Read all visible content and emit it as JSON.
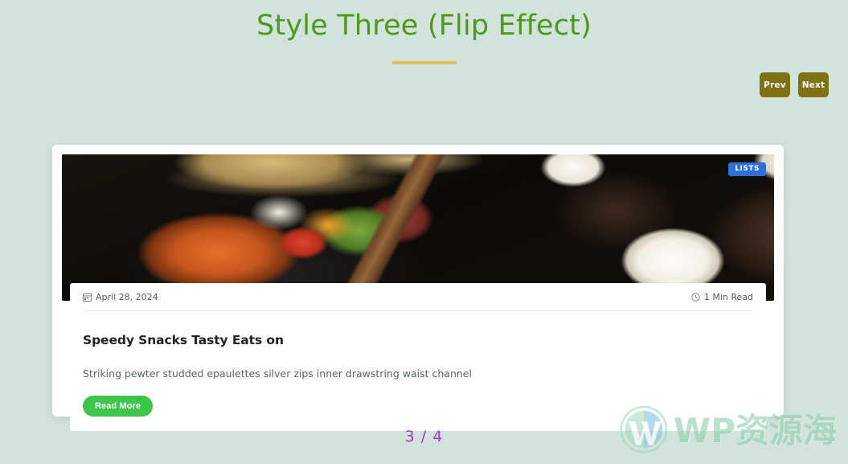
{
  "header": {
    "title": "Style Three (Flip Effect)",
    "accent_color": "#4c9a16",
    "rule_color": "#ddbe54"
  },
  "nav": {
    "prev_label": "Prev",
    "next_label": "Next",
    "button_color": "#7f7214"
  },
  "card": {
    "badge": "LISTS",
    "badge_color": "#2d6fd6",
    "date": "April 28, 2024",
    "date_icon": "calendar-icon",
    "read_time": "1 Min Read",
    "read_time_icon": "clock-icon",
    "title": "Speedy Snacks Tasty Eats on",
    "excerpt": "Striking pewter studded epaulettes silver zips inner drawstring waist channel",
    "read_more_label": "Read More",
    "read_more_color": "#3ec64a"
  },
  "pagination": {
    "counter": "3 / 4",
    "color": "#b02fd1"
  },
  "watermark": {
    "text": "WP资源海",
    "logo": "wordpress-logo"
  },
  "page": {
    "background_color": "#d2e2dd"
  }
}
